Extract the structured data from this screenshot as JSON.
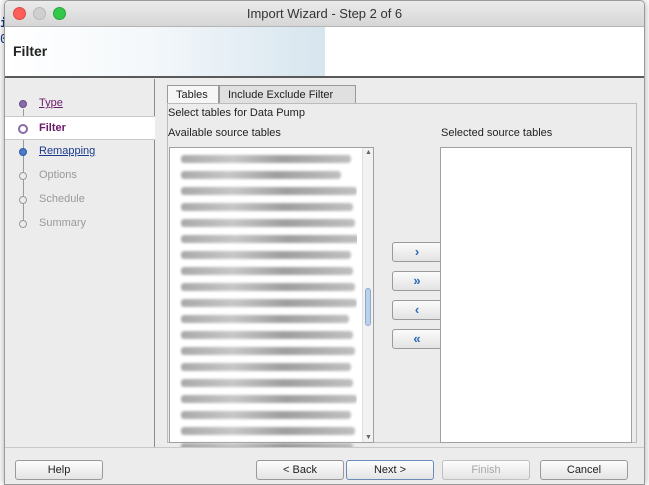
{
  "window": {
    "title": "Import Wizard - Step 2 of 6"
  },
  "header": {
    "title": "Filter"
  },
  "steps": [
    {
      "label": "Type",
      "state": "done"
    },
    {
      "label": "Filter",
      "state": "current"
    },
    {
      "label": "Remapping",
      "state": "link"
    },
    {
      "label": "Options",
      "state": "future"
    },
    {
      "label": "Schedule",
      "state": "future"
    },
    {
      "label": "Summary",
      "state": "future"
    }
  ],
  "tabs": [
    {
      "label": "Tables",
      "selected": true
    },
    {
      "label": "Include Exclude Filter",
      "selected": false
    }
  ],
  "filter": {
    "heading": "Select tables for Data Pump",
    "available_label": "Available source tables",
    "selected_label": "Selected source tables",
    "available_items_count_visible": 19,
    "selected_items": []
  },
  "move_buttons": [
    {
      "name": "move-selected-right",
      "glyph": "›",
      "icon": "chevron-right-icon"
    },
    {
      "name": "move-all-right",
      "glyph": "»",
      "icon": "double-chevron-right-icon"
    },
    {
      "name": "move-selected-left",
      "glyph": "‹",
      "icon": "chevron-left-icon"
    },
    {
      "name": "move-all-left",
      "glyph": "«",
      "icon": "double-chevron-left-icon"
    }
  ],
  "buttons": {
    "help": "Help",
    "back": "< Back",
    "next": "Next >",
    "finish": "Finish",
    "cancel": "Cancel"
  },
  "colors": {
    "accent": "#2a6ab8",
    "step_done": "#6a1a6a",
    "step_future": "#9a9a9a"
  }
}
